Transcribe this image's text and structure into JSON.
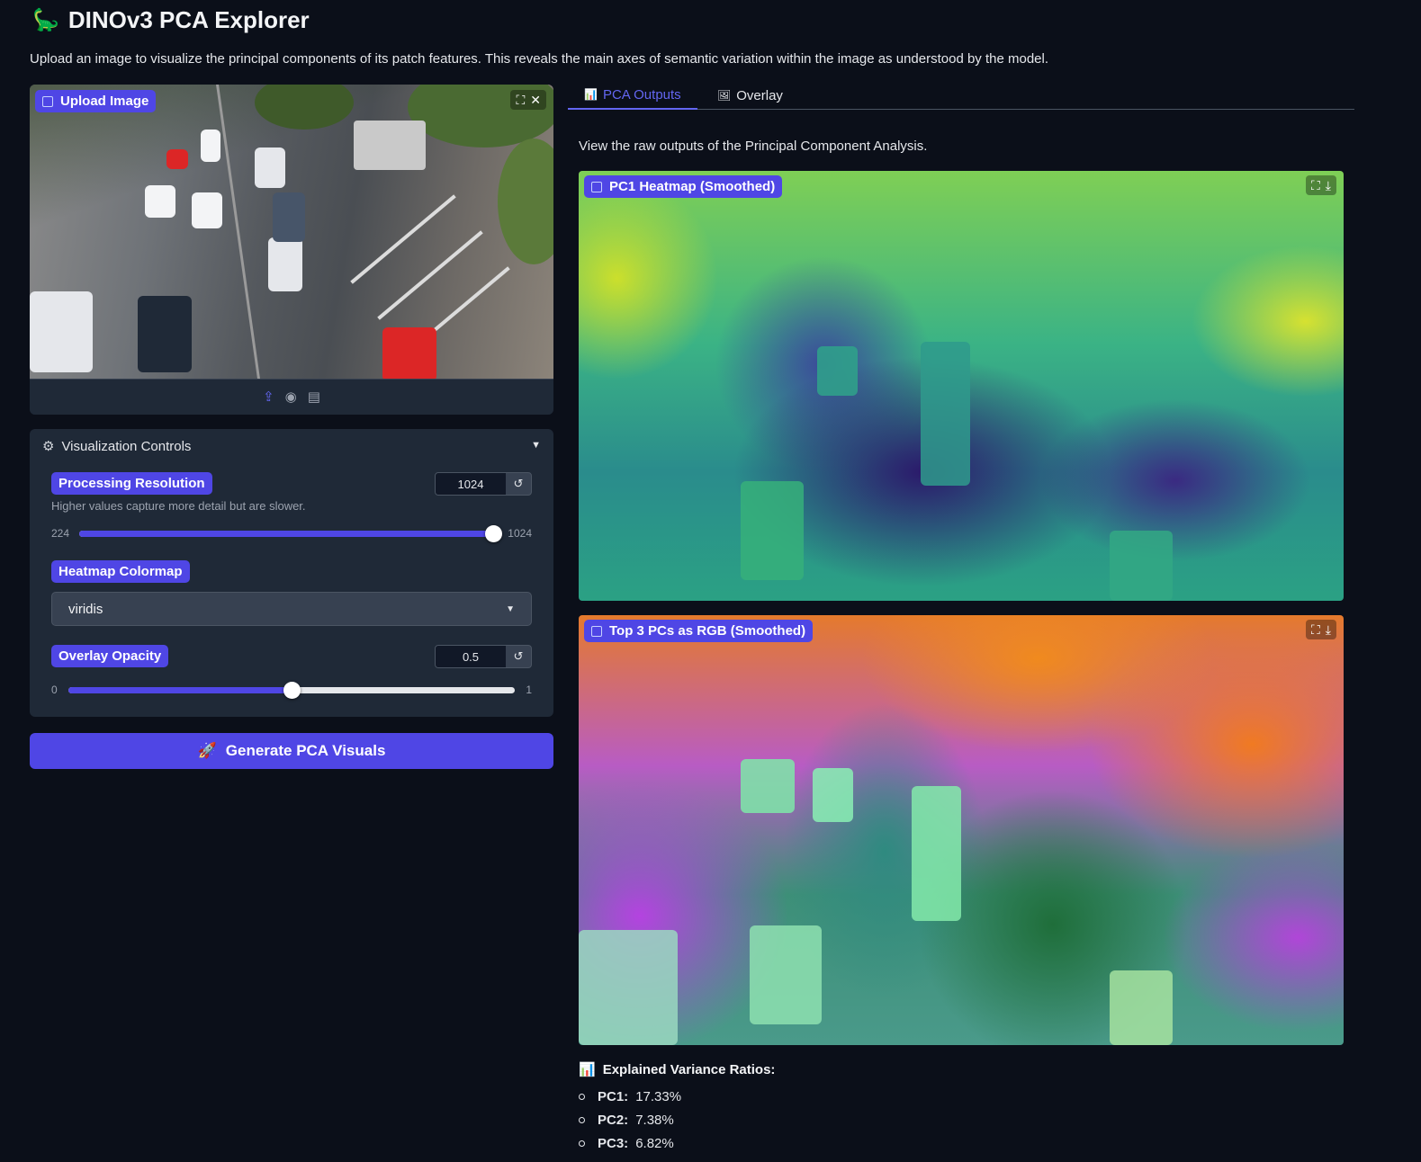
{
  "header": {
    "title": "DINOv3 PCA Explorer",
    "title_icon": "dinosaur-emoji",
    "description": "Upload an image to visualize the principal components of its patch features. This reveals the main axes of semantic variation within the image as understood by the model."
  },
  "upload": {
    "label": "Upload Image",
    "fullscreen_icon": "fullscreen-icon",
    "close_icon": "close-icon",
    "toolbar_icons": [
      "upload-icon",
      "webcam-icon",
      "clipboard-icon"
    ]
  },
  "controls": {
    "header": "Visualization Controls",
    "resolution": {
      "label": "Processing Resolution",
      "value": "1024",
      "hint": "Higher values capture more detail but are slower.",
      "min": "224",
      "max": "1024",
      "fraction": 1.0
    },
    "colormap": {
      "label": "Heatmap Colormap",
      "value": "viridis"
    },
    "opacity": {
      "label": "Overlay Opacity",
      "value": "0.5",
      "min": "0",
      "max": "1",
      "fraction": 0.5
    }
  },
  "generate_button": "Generate PCA Visuals",
  "tabs": {
    "pca": "PCA Outputs",
    "overlay": "Overlay",
    "active": "pca"
  },
  "outputs": {
    "description": "View the raw outputs of the Principal Component Analysis.",
    "pc1_label": "PC1 Heatmap (Smoothed)",
    "rgb_label": "Top 3 PCs as RGB (Smoothed)"
  },
  "variance": {
    "title": "Explained Variance Ratios:",
    "items": [
      {
        "name": "PC1:",
        "value": "17.33%"
      },
      {
        "name": "PC2:",
        "value": "7.38%"
      },
      {
        "name": "PC3:",
        "value": "6.82%"
      }
    ]
  },
  "colors": {
    "accent": "#4f46e5",
    "background": "#0b0f19",
    "panel": "#1f2937"
  }
}
